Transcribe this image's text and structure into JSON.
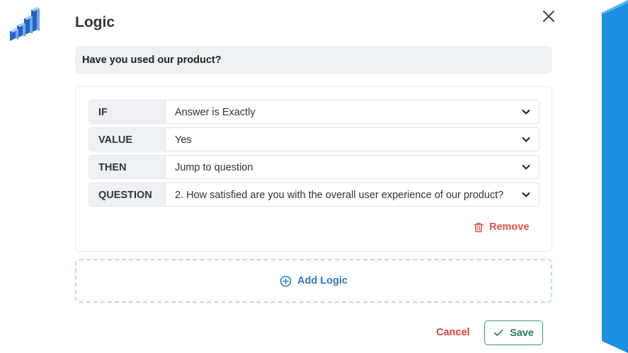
{
  "modal": {
    "title": "Logic",
    "question": "Have you used our product?"
  },
  "rules": [
    {
      "label": "IF",
      "value": "Answer is Exactly"
    },
    {
      "label": "VALUE",
      "value": "Yes"
    },
    {
      "label": "THEN",
      "value": "Jump to question"
    },
    {
      "label": "QUESTION",
      "value": "2. How satisfied are you with the overall user experience of our product?"
    }
  ],
  "actions": {
    "remove_label": "Remove",
    "add_logic_label": "Add Logic",
    "cancel_label": "Cancel",
    "save_label": "Save"
  },
  "icons": {
    "logo": "bar-chart-logo-icon",
    "close": "close-icon",
    "chevron": "chevron-down-icon",
    "trash": "trash-icon",
    "add": "plus-circle-icon",
    "check": "check-icon"
  },
  "colors": {
    "accent_blue": "#2f78c4",
    "panel_blue": "#1e8fdf",
    "danger_red": "#e05252",
    "success_green": "#3c9a6a",
    "field_bg": "#eef1f4"
  }
}
